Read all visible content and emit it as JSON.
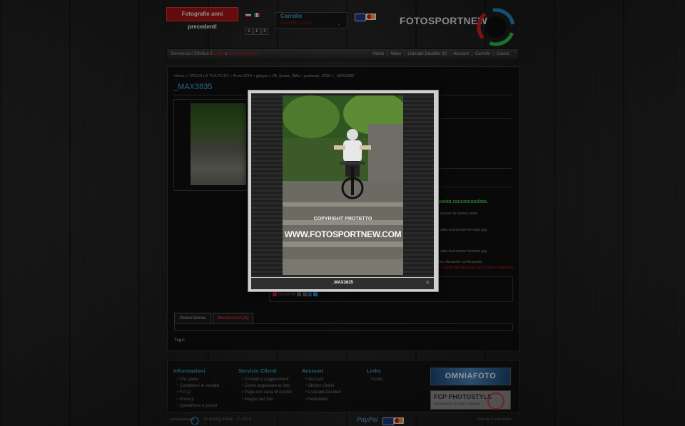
{
  "header": {
    "prev_photos_label": "Fotografie anni precedenti",
    "currencies": [
      "€",
      "£",
      "$"
    ],
    "cart_title": "Carrello",
    "cart_status": "Carrello vuoto",
    "logo_text": "FOTOSPORTNEW"
  },
  "nav": {
    "welcome_prefix": "Benvenuto! Effettua il",
    "login": "Login",
    "welcome_mid": "o",
    "register": "crea un account",
    "links": [
      "Home",
      "News",
      "Lista dei Desideri (0)",
      "Account",
      "Carrello",
      "Cassa"
    ]
  },
  "breadcrumb": "Home » TROVA LA TUA FOTO » Anno 2014 » giugno » 08_Soave_Bike » pettorale_0290 » _MAX3835",
  "product": {
    "title": "_MAX3835",
    "recommended": "posta raccomandata.",
    "lines": [
      "o presso la nostra sede",
      "d alta risoluzione formato jpg",
      "d alta risoluzione formato jpg",
      "una cliccando su Acquista"
    ],
    "red_note": "on i diritti del fotografo per l'utilizzo della foto",
    "share": "Condividi"
  },
  "tabs": [
    "Descrizione",
    "Recensioni (0)"
  ],
  "tags_label": "Tags:",
  "footer": {
    "columns": [
      {
        "title": "Informazioni",
        "items": [
          "Chi siamo",
          "Condizioni di vendita",
          "F.A.Q.",
          "Privacy",
          "Spedizione e prezzi"
        ]
      },
      {
        "title": "Servizio Clienti",
        "items": [
          "Contatti e suggerimenti",
          "Come acquistare le foto",
          "Paga con carta di credito",
          "Mappa del Sito"
        ]
      },
      {
        "title": "Account",
        "items": [
          "Account",
          "Storico Ordini",
          "Lista dei Desideri",
          "Newsletter"
        ]
      },
      {
        "title": "Links",
        "items": [
          "Links"
        ]
      }
    ],
    "banner1": "OMNIAFOTO",
    "banner2_title": "FCP PHOTOSTYLE",
    "banner2_sub": "photographer & graphic designer",
    "brand_small": "FOTOSPORTNEW",
    "copyright": "shopping online - © 2013",
    "paypal": "PayPal",
    "credit_red": "A",
    "credit_rest": "ssofts © web tools"
  },
  "modal": {
    "caption": "_MAX3835",
    "watermark_small": "COPYRIGHT PROTETTO",
    "watermark_big": "WWW.FOTOSPORTNEW.COM",
    "close": "×"
  }
}
